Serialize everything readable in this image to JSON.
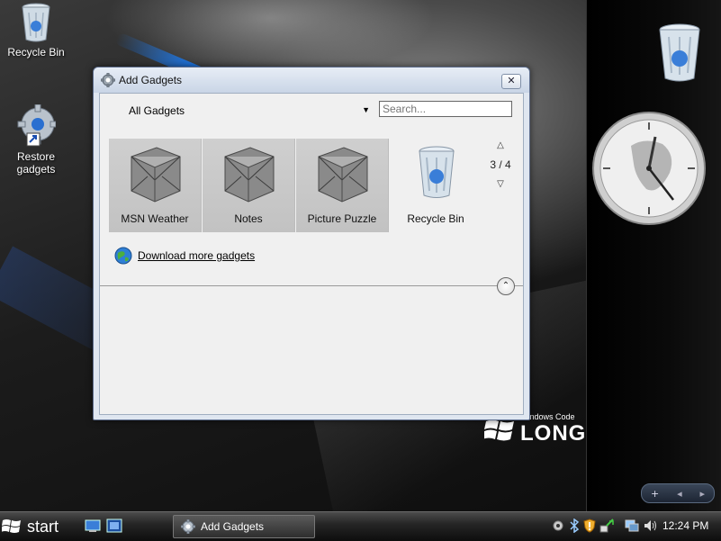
{
  "desktop": {
    "icons": [
      {
        "name": "recycle-bin",
        "label": "Recycle Bin"
      },
      {
        "name": "restore-gadgets",
        "label": "Restore gadgets"
      }
    ],
    "brand": {
      "small": "Windows Code",
      "big": "LONGH"
    }
  },
  "dialog": {
    "title": "Add Gadgets",
    "close_label": "✕",
    "category": "All Gadgets",
    "search_placeholder": "Search...",
    "gadgets": [
      {
        "label": "MSN Weather",
        "selected": true
      },
      {
        "label": "Notes",
        "selected": true
      },
      {
        "label": "Picture Puzzle",
        "selected": true
      },
      {
        "label": "Recycle Bin",
        "selected": false
      }
    ],
    "pager": {
      "up": "△",
      "text": "3 / 4",
      "down": "▽"
    },
    "download_link": "Download more gadgets",
    "collapse_icon": "⌃"
  },
  "sidebar": {
    "gadgets": [
      "recycle-bin",
      "clock"
    ],
    "controls": {
      "add": "+",
      "prev": "◂",
      "next": "▸"
    }
  },
  "taskbar": {
    "start_label": "start",
    "task_button": "Add Gadgets",
    "clock": "12:24 PM",
    "tray_icons": [
      "gear-icon",
      "bluetooth-icon",
      "shield-icon",
      "network-icon",
      "display-icon",
      "volume-icon"
    ]
  },
  "colors": {
    "accent_blue": "#1d74e0",
    "titlebar": "#c9d5e6",
    "dialog_bg": "#f0f0f0"
  }
}
